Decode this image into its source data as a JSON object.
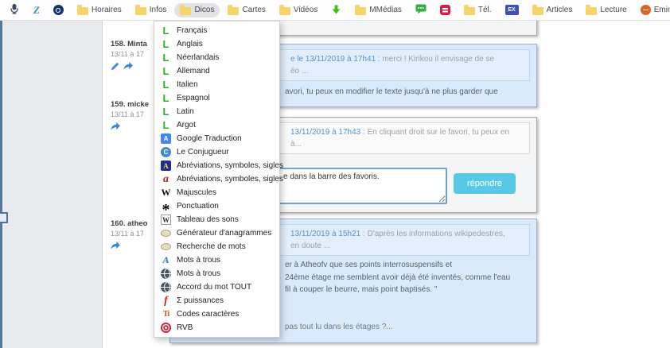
{
  "bookmarks_bar": {
    "items": [
      {
        "icon": "mic-icon"
      },
      {
        "icon": "z-icon"
      },
      {
        "icon": "o-circle-icon"
      },
      {
        "label": "Horaires",
        "icon": "folder-icon"
      },
      {
        "label": "Infos",
        "icon": "folder-icon"
      },
      {
        "label": "Dicos",
        "icon": "folder-icon",
        "active": true
      },
      {
        "label": "Cartes",
        "icon": "folder-icon"
      },
      {
        "label": "Vidéos",
        "icon": "folder-icon"
      },
      {
        "icon": "green-arrow-icon"
      },
      {
        "label": "MMédias",
        "icon": "folder-icon"
      },
      {
        "icon": "green-chat-icon"
      },
      {
        "icon": "red-menu-icon"
      },
      {
        "label": "Tél.",
        "icon": "folder-icon"
      },
      {
        "label": "EX",
        "icon": "ex-icon"
      },
      {
        "label": "Articles",
        "icon": "folder-icon"
      },
      {
        "label": "Lecture",
        "icon": "folder-icon"
      },
      {
        "label": "Eminent Ewent EW...",
        "icon": "orange-circle-icon"
      }
    ]
  },
  "dicos_menu": {
    "items": [
      {
        "label": "Français",
        "icon": "larousse-icon"
      },
      {
        "label": "Anglais",
        "icon": "larousse-icon"
      },
      {
        "label": "Néerlandais",
        "icon": "larousse-icon"
      },
      {
        "label": "Allemand",
        "icon": "larousse-icon"
      },
      {
        "label": "Italien",
        "icon": "larousse-icon"
      },
      {
        "label": "Espagnol",
        "icon": "larousse-icon"
      },
      {
        "label": "Latin",
        "icon": "larousse-icon"
      },
      {
        "label": "Argot",
        "icon": "larousse-icon"
      },
      {
        "label": "Google Traduction",
        "icon": "google-translate-icon"
      },
      {
        "label": "Le Conjugueur",
        "icon": "conjugueur-icon"
      },
      {
        "label": "Abréviations, symboles, sigles",
        "icon": "blue-a-icon"
      },
      {
        "label": "Abréviations, symboles, sigles",
        "icon": "red-a-icon"
      },
      {
        "label": "Majuscules",
        "icon": "wikipedia-w-icon"
      },
      {
        "label": "Ponctuation",
        "icon": "black-star-icon"
      },
      {
        "label": "Tableau des sons",
        "icon": "boxed-w-icon"
      },
      {
        "label": "Générateur d'anagrammes",
        "icon": "oval-icon"
      },
      {
        "label": "Recherche de mots",
        "icon": "oval-icon"
      },
      {
        "label": "Mots à trous",
        "icon": "blue-italic-a-icon"
      },
      {
        "label": "Mots à trous",
        "icon": "globe-icon"
      },
      {
        "label": "Accord du mot TOUT",
        "icon": "globe-icon"
      },
      {
        "label": "Σ puissances",
        "icon": "red-f-icon"
      },
      {
        "label": "Codes caractères",
        "icon": "ti-icon"
      },
      {
        "label": "RVB",
        "icon": "rvb-icon"
      }
    ]
  },
  "thread": {
    "entries": [
      {
        "label": "158. Minta",
        "date": "13/11 à 17"
      },
      {
        "label": "159. micke",
        "date": "13/11 à 17"
      },
      {
        "label": "160. atheo",
        "date": "13/11 à 17"
      }
    ]
  },
  "messages": {
    "m158": {
      "quote_link": "e le 13/11/2019 à 17h41",
      "quote_text": " : merci ! Kirikou il envisage de se",
      "quote_line2": "éo ...",
      "body": "avori, tu peux en modifier le texte jusqu'à ne plus garder que"
    },
    "m159": {
      "quote_link": "13/11/2019 à 17h43",
      "quote_text": " : En cliquant droit sur le favori, tu peux en",
      "quote_line2": "à...",
      "reply_value": "e dans la barre des favoris.",
      "reply_button": "répondre"
    },
    "m160": {
      "quote_link": "13/11/2019 à 15h21",
      "quote_text": " : D'après les informations wikipedestres,",
      "quote_line2": "en doute ...",
      "body_line1": "er à Atheofv que ses points interrosuspensifs et",
      "body_line2": "24ème étage me semblent avoir déjà été inventés, comme l'eau",
      "body_line3": "fil à couper le beurre, mais point baptisés. \"",
      "body_line4": "pas tout lu dans les étages ?..."
    }
  },
  "colors": {
    "accent_button": "#58c8e6",
    "link_blue": "#4f94d4",
    "message_blue_bg": "#d8eafc",
    "folder_yellow": "#f6d469",
    "larousse_green": "#27b327"
  }
}
